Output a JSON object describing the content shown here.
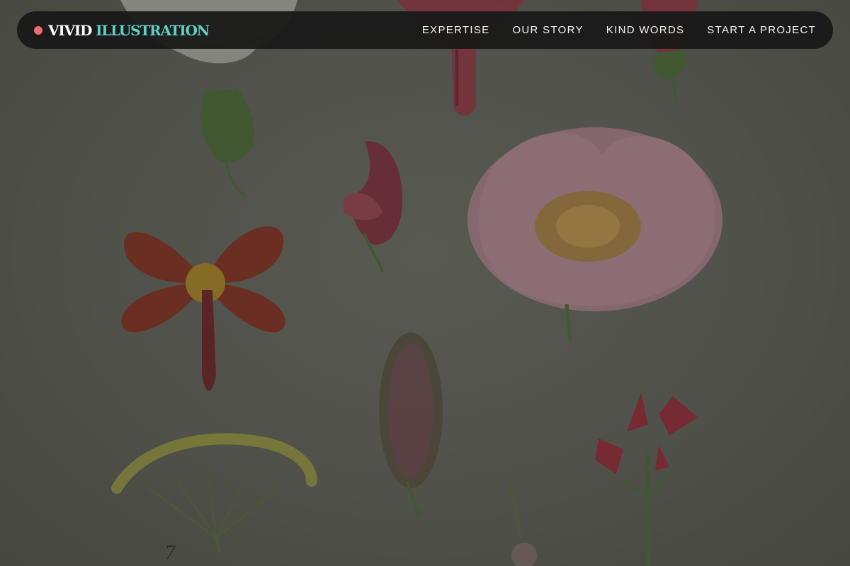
{
  "brand": {
    "name_first": "VIVID",
    "name_second": "ILLUSTRATION",
    "dot_color": "#f06b6b",
    "accent_color": "#5fd0c6"
  },
  "nav": {
    "items": [
      {
        "label": "EXPERTISE"
      },
      {
        "label": "OUR STORY"
      },
      {
        "label": "KIND WORDS"
      },
      {
        "label": "START A PROJECT"
      }
    ]
  },
  "hero": {
    "plate_number": "7"
  }
}
